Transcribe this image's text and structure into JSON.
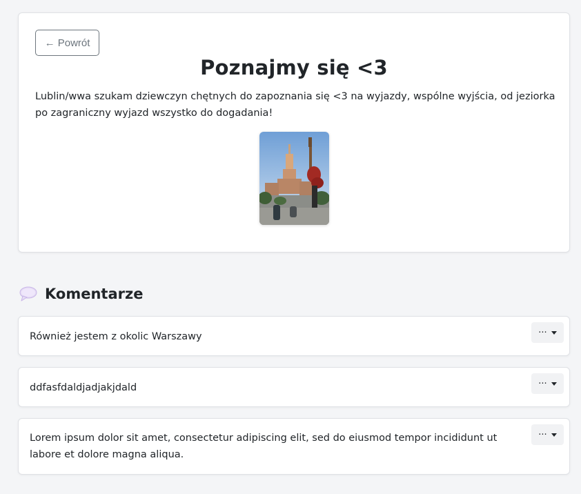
{
  "post": {
    "back_label": "← Powrót",
    "title": "Poznajmy się <3",
    "body": "Lublin/wwa szukam dziewczyn chętnych do zapoznania się <3 na wyjazdy, wspólne wyjścia, od jeziorka po zagraniczny wyjazd wszystko do dogadania!",
    "photo_icon": "city-photo"
  },
  "comments_section": {
    "icon": "speech-bubble-icon",
    "title": "Komentarze"
  },
  "comments": [
    {
      "text": "Również jestem z okolic Warszawy",
      "menu_label": "···"
    },
    {
      "text": "ddfasfdaldjadjakjdald",
      "menu_label": "···"
    },
    {
      "text": "Lorem ipsum dolor sit amet, consectetur adipiscing elit, sed do eiusmod tempor incididunt ut labore et dolore magna aliqua.",
      "menu_label": "···"
    }
  ]
}
